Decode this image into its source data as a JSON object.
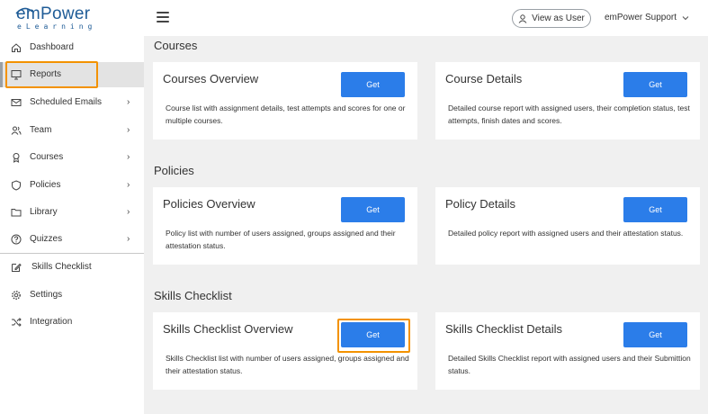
{
  "brand": {
    "logo_main": "emPower",
    "logo_sub": "eLearning"
  },
  "header": {
    "view_as_user": "View as User",
    "user_name": "emPower Support"
  },
  "sidebar": {
    "items": [
      {
        "label": "Dashboard",
        "icon": "home-icon",
        "chevron": false
      },
      {
        "label": "Reports",
        "icon": "monitor-icon",
        "chevron": false,
        "active": true
      },
      {
        "label": "Scheduled Emails",
        "icon": "envelope-icon",
        "chevron": true
      },
      {
        "label": "Team",
        "icon": "users-icon",
        "chevron": true
      },
      {
        "label": "Courses",
        "icon": "award-icon",
        "chevron": true
      },
      {
        "label": "Policies",
        "icon": "shield-icon",
        "chevron": true
      },
      {
        "label": "Library",
        "icon": "folder-icon",
        "chevron": true
      },
      {
        "label": "Quizzes",
        "icon": "question-icon",
        "chevron": true
      },
      {
        "label": "Skills Checklist",
        "icon": "edit-icon",
        "chevron": false
      },
      {
        "label": "Settings",
        "icon": "gear-icon",
        "chevron": false
      },
      {
        "label": "Integration",
        "icon": "shuffle-icon",
        "chevron": false
      }
    ]
  },
  "sections": [
    {
      "title": "Courses",
      "cards": [
        {
          "title": "Courses Overview",
          "button": "Get",
          "desc": "Course list with assignment details, test attempts and scores for one or multiple courses."
        },
        {
          "title": "Course Details",
          "button": "Get",
          "desc": "Detailed course report with assigned users, their completion status, test attempts, finish dates and scores."
        }
      ]
    },
    {
      "title": "Policies",
      "cards": [
        {
          "title": "Policies Overview",
          "button": "Get",
          "desc": "Policy list with number of users assigned, groups assigned and their attestation status."
        },
        {
          "title": "Policy Details",
          "button": "Get",
          "desc": "Detailed policy report with assigned users and their attestation status."
        }
      ]
    },
    {
      "title": "Skills Checklist",
      "cards": [
        {
          "title": "Skills Checklist Overview",
          "button": "Get",
          "desc": "Skills Checklist list with number of users assigned, groups assigned and their attestation status."
        },
        {
          "title": "Skills Checklist Details",
          "button": "Get",
          "desc": "Detailed Skills Checklist report with assigned users and their Submittion status."
        }
      ]
    }
  ],
  "colors": {
    "primary_button": "#2b7de9",
    "highlight": "#f39200",
    "brand": "#1f5c97",
    "background": "#f0f0f0"
  }
}
